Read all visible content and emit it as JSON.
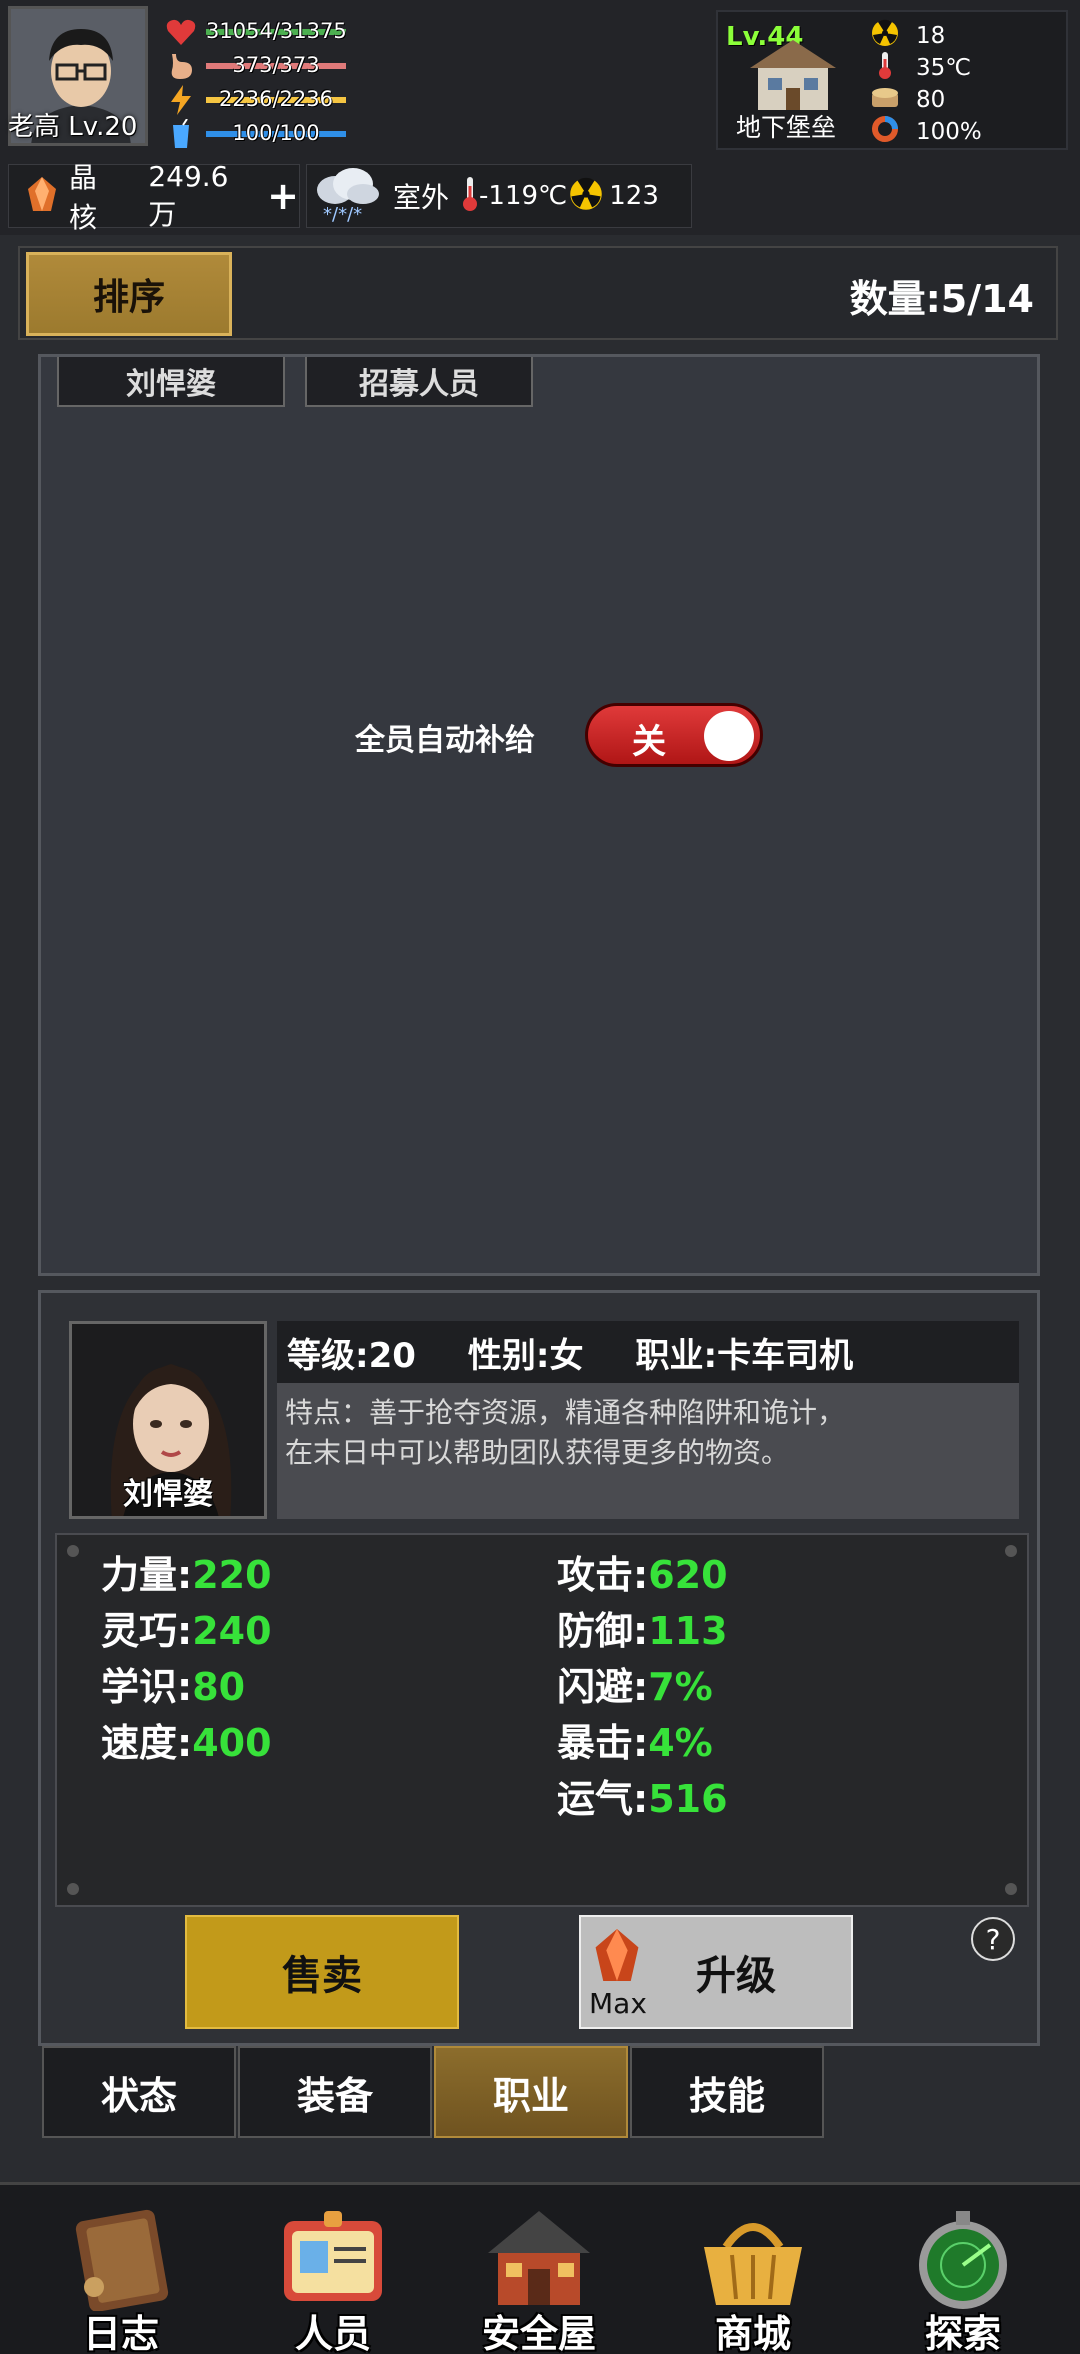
{
  "player": {
    "name": "老高 Lv.20",
    "hp": "31054/31375",
    "hunger": "373/373",
    "energy": "2236/2236",
    "water": "100/100"
  },
  "shelter": {
    "level": "Lv.44",
    "name": "地下堡垒",
    "radiation": "18",
    "temperature": "35℃",
    "food": "80",
    "durability": "100%"
  },
  "resources": {
    "crystal_label": "晶核",
    "crystal_value": "249.6万",
    "add_symbol": "+"
  },
  "weather": {
    "location": "室外",
    "temperature": "-119℃",
    "radiation": "123"
  },
  "sort": {
    "button_label": "排序",
    "count": "数量:5/14"
  },
  "list": {
    "tab1": "刘悍婆",
    "tab2": "招募人员",
    "auto_supply_label": "全员自动补给",
    "toggle_label": "关"
  },
  "detail": {
    "name": "刘悍婆",
    "level": "等级:20",
    "gender": "性别:女",
    "job": "职业:卡车司机",
    "desc_line1": "特点：善于抢夺资源，精通各种陷阱和诡计，",
    "desc_line2": "在末日中可以帮助团队获得更多的物资。",
    "stats_left": [
      {
        "label": "力量:",
        "value": "220"
      },
      {
        "label": "灵巧:",
        "value": "240"
      },
      {
        "label": "学识:",
        "value": "80"
      },
      {
        "label": "速度:",
        "value": "400"
      }
    ],
    "stats_right": [
      {
        "label": "攻击:",
        "value": "620"
      },
      {
        "label": "防御:",
        "value": "113"
      },
      {
        "label": "闪避:",
        "value": "7%"
      },
      {
        "label": "暴击:",
        "value": "4%"
      },
      {
        "label": "运气:",
        "value": "516"
      }
    ],
    "sell_label": "售卖",
    "upgrade_label": "升级",
    "max_label": "Max",
    "help_label": "?"
  },
  "tabs": [
    "状态",
    "装备",
    "职业",
    "技能"
  ],
  "active_tab": "职业",
  "nav": [
    "日志",
    "人员",
    "安全屋",
    "商城",
    "探索"
  ],
  "colors": {
    "stat_value": "#37e23a",
    "level_green": "#8cff3a",
    "gold": "#c29a1a",
    "toggle_red": "#d42626"
  }
}
